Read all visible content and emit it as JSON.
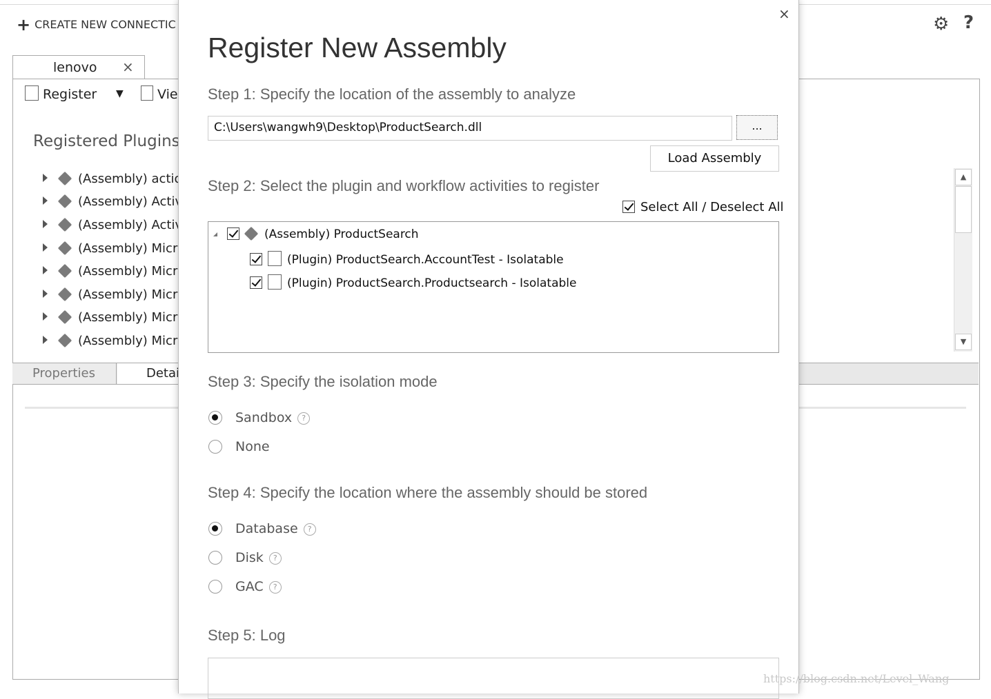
{
  "app": {
    "create_connection": "CREATE NEW CONNECTIC",
    "tab_name": "lenovo",
    "tab_close": "×",
    "register_label": "Register",
    "view_label": "Vie",
    "registered_heading": "Registered Plugins &",
    "assemblies": [
      "(Assembly) action",
      "(Assembly) Activit",
      "(Assembly) Activit",
      "(Assembly) Micro",
      "(Assembly) Micro",
      "(Assembly) Micro",
      "(Assembly) Micro",
      "(Assembly) Micro"
    ],
    "bottom_tabs": {
      "properties": "Properties",
      "details": "Detai"
    },
    "watermark": "https://blog.csdn.net/Level_Wang"
  },
  "dialog": {
    "title": "Register New Assembly",
    "close": "×",
    "step1": "Step 1: Specify the location of the assembly to analyze",
    "assembly_path": "C:\\Users\\wangwh9\\Desktop\\ProductSearch.dll",
    "browse_label": "...",
    "load_label": "Load Assembly",
    "step2": "Step 2: Select the plugin and workflow activities to register",
    "select_all": "Select All / Deselect All",
    "tree": {
      "assembly": "(Assembly) ProductSearch",
      "plugins": [
        "(Plugin) ProductSearch.AccountTest - Isolatable",
        "(Plugin) ProductSearch.Productsearch - Isolatable"
      ]
    },
    "step3": "Step 3: Specify the isolation mode",
    "isolation_options": [
      "Sandbox",
      "None"
    ],
    "isolation_selected": "Sandbox",
    "step4": "Step 4: Specify the location where the assembly should be stored",
    "storage_options": [
      "Database",
      "Disk",
      "GAC"
    ],
    "storage_selected": "Database",
    "step5": "Step 5: Log",
    "help_glyph": "?"
  }
}
